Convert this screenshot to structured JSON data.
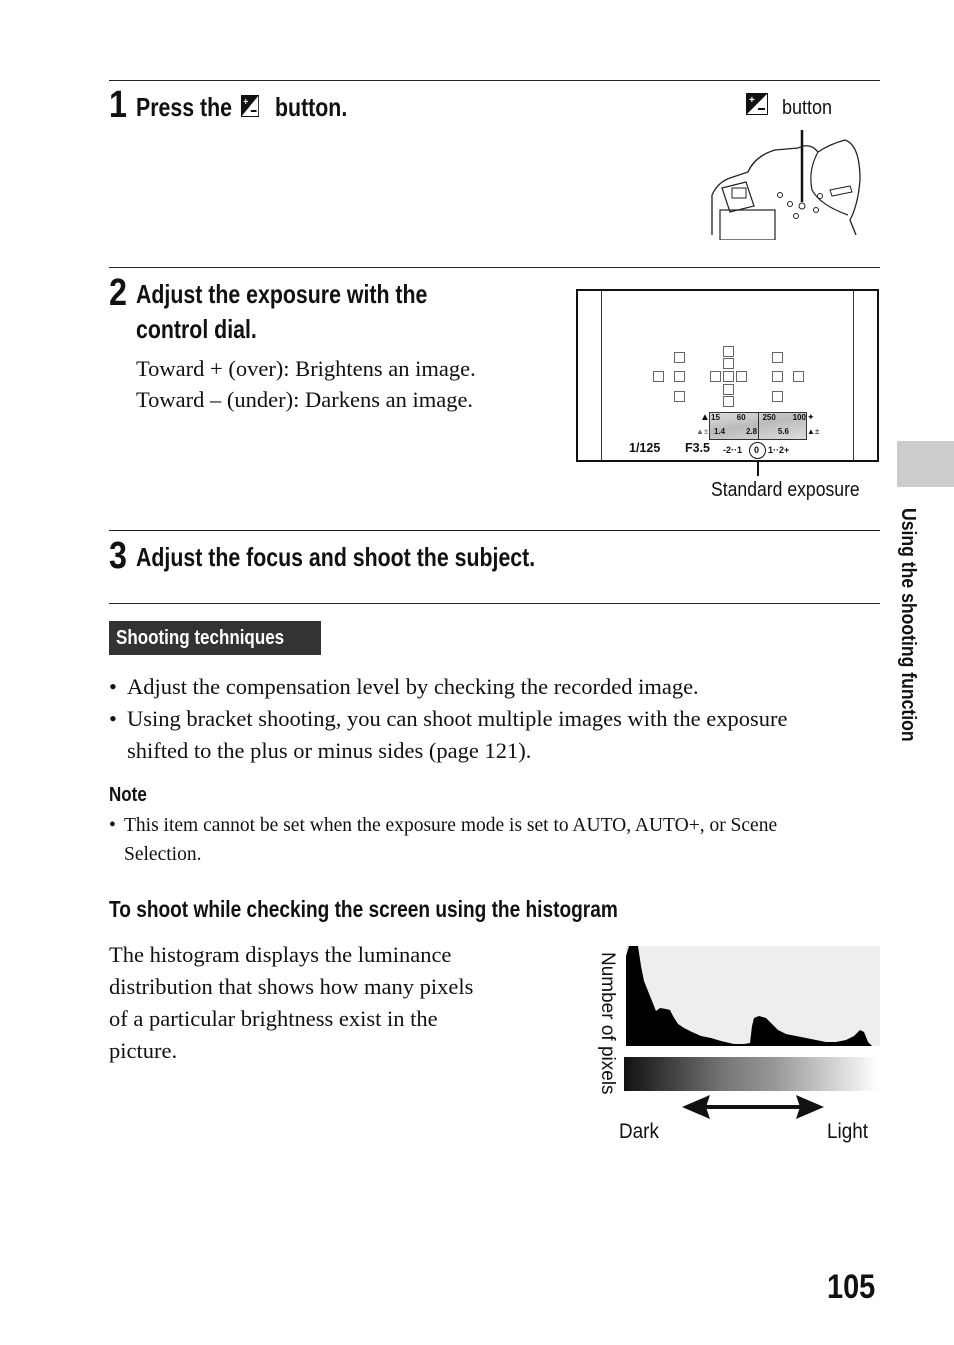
{
  "steps": [
    {
      "number": "1",
      "heading_before": "Press the",
      "heading_icon": "exposure-compensation-icon",
      "heading_after": "button."
    },
    {
      "number": "2",
      "heading_line1": "Adjust the exposure with the",
      "heading_line2": "control dial.",
      "body": [
        "Toward + (over): Brightens an image.",
        "Toward – (under): Darkens an image."
      ]
    },
    {
      "number": "3",
      "heading": "Adjust the focus and shoot the subject."
    }
  ],
  "camera_figure": {
    "label": "button",
    "icon": "exposure-compensation-icon"
  },
  "viewfinder_figure": {
    "scale_top": [
      "15",
      "60",
      "250",
      "100"
    ],
    "scale_bottom": [
      "1.4",
      "2.8",
      "5.6"
    ],
    "shutter": "1/125",
    "aperture": "F3.5",
    "ev_scale": "-2··1",
    "ev_zero": "0",
    "ev_scale_right": "1··2+",
    "caption": "Standard exposure"
  },
  "shooting_techniques": {
    "tab_label": "Shooting techniques",
    "bullets": [
      "Adjust the compensation level by checking the recorded image.",
      "Using bracket shooting, you can shoot multiple images with the exposure",
      "shifted to the plus or minus sides (page 121)."
    ]
  },
  "note": {
    "title": "Note",
    "line1": "This item cannot be set when the exposure mode is set to AUTO, AUTO+, or Scene",
    "line2": "Selection."
  },
  "histogram_section": {
    "heading": "To shoot while checking the screen using the histogram",
    "body": [
      "The histogram displays the luminance",
      "distribution that shows how many pixels",
      "of a particular brightness exist in the",
      "picture."
    ],
    "figure": {
      "y_label": "Number of pixels",
      "dark_label": "Dark",
      "light_label": "Light"
    }
  },
  "side_tab": {
    "label": "Using the shooting function"
  },
  "page_number": "105"
}
